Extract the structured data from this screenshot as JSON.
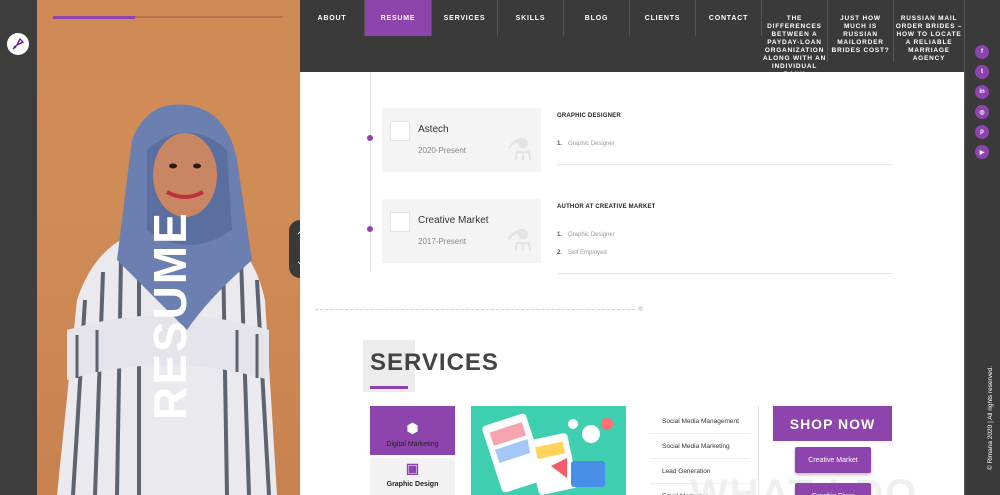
{
  "brand": {
    "logo_icon": "pen-nib-icon",
    "accent": "#8e44ad"
  },
  "hero": {
    "vertical_title": "RESUME"
  },
  "scroll": {
    "up_icon": "chevron-up-icon",
    "down_icon": "chevron-down-icon"
  },
  "nav": {
    "items": [
      {
        "label": "ABOUT"
      },
      {
        "label": "RESUME",
        "active": true
      },
      {
        "label": "SERVICES"
      },
      {
        "label": "SKILLS"
      },
      {
        "label": "BLOG"
      },
      {
        "label": "CLIENTS"
      },
      {
        "label": "CONTACT"
      },
      {
        "label": "THE DIFFERENCES BETWEEN A PAYDAY-LOAN ORGANIZATION ALONG WITH AN INDIVIDUAL BANK"
      },
      {
        "label": "JUST HOW MUCH IS RUSSIAN MAILORDER BRIDES COST?"
      },
      {
        "label": "RUSSIAN MAIL ORDER BRIDES – HOW TO LOCATE A RELIABLE MARRIAGE AGENCY"
      }
    ]
  },
  "social": [
    {
      "icon": "facebook-icon",
      "glyph": "f"
    },
    {
      "icon": "twitter-icon",
      "glyph": "t"
    },
    {
      "icon": "linkedin-icon",
      "glyph": "in"
    },
    {
      "icon": "instagram-icon",
      "glyph": "◎"
    },
    {
      "icon": "pinterest-icon",
      "glyph": "p"
    },
    {
      "icon": "youtube-icon",
      "glyph": "▶"
    }
  ],
  "footer": {
    "copyright": "© Rimana 2020 | All rights reserved."
  },
  "resume": {
    "entries": [
      {
        "company": "Astech",
        "years": "2020-Present",
        "title": "GRAPHIC DESIGNER",
        "items": [
          {
            "num": "1.",
            "text": "Graphic Designer"
          }
        ]
      },
      {
        "company": "Creative Market",
        "years": "2017-Present",
        "title": "AUTHOR AT CREATIVE MARKET",
        "items": [
          {
            "num": "1.",
            "text": "Graphic Designer"
          },
          {
            "num": "2.",
            "text": "Self Employed"
          }
        ]
      }
    ]
  },
  "services": {
    "title": "SERVICES",
    "tabs": [
      {
        "label": "Digital Marketing",
        "icon": "cubes-icon",
        "active": true
      },
      {
        "label": "Graphic Design",
        "icon": "image-icon",
        "active": false
      }
    ],
    "list": [
      "Social Media Management",
      "Social Media Marketing",
      "Lead Generation",
      "Email Marketing"
    ],
    "watermark": "WHAT I DO",
    "shop": {
      "title": "SHOP NOW",
      "links": [
        "Creative Market",
        "Graphic River"
      ]
    }
  }
}
